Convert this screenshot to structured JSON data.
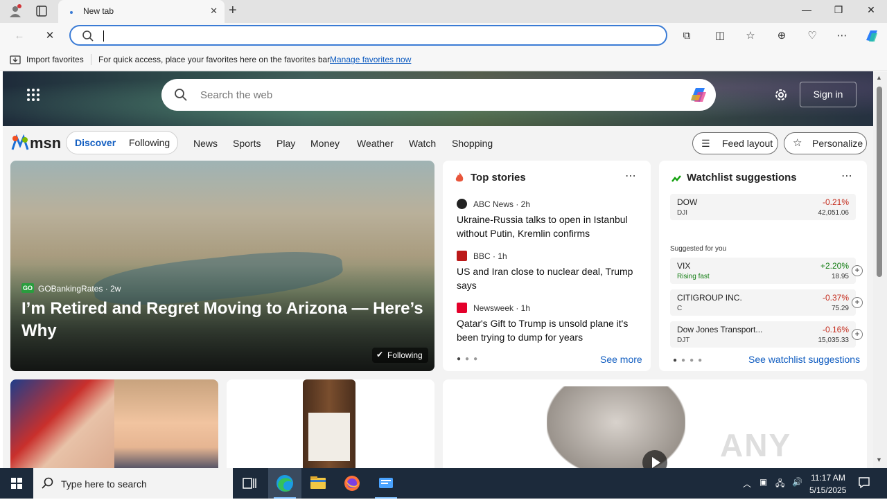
{
  "browser": {
    "tab_title": "New tab",
    "address_value": "",
    "favorites_bar": {
      "import_label": "Import favorites",
      "message": "For quick access, place your favorites here on the favorites bar.",
      "manage_link": "Manage favorites now"
    }
  },
  "msn": {
    "search_placeholder": "Search the web",
    "sign_in": "Sign in",
    "logo": "msn",
    "segments": [
      "Discover",
      "Following"
    ],
    "nav": [
      "News",
      "Sports",
      "Play",
      "Money",
      "Weather",
      "Watch",
      "Shopping"
    ],
    "feed_layout": "Feed layout",
    "personalize": "Personalize",
    "featured": {
      "source": "GOBankingRates",
      "age": "2w",
      "headline": "I’m Retired and Regret Moving to Arizona — Here’s Why",
      "following": "Following"
    },
    "top_stories": {
      "title": "Top stories",
      "stories": [
        {
          "source": "ABC News · 2h",
          "headline": "Ukraine-Russia talks to open in Istanbul without Putin, Kremlin confirms"
        },
        {
          "source": "BBC · 1h",
          "headline": "US and Iran close to nuclear deal, Trump says"
        },
        {
          "source": "Newsweek · 1h",
          "headline": "Qatar's Gift to Trump is unsold plane it's been trying to dump for years"
        }
      ],
      "see_more": "See more"
    },
    "watchlist": {
      "title": "Watchlist suggestions",
      "suggested_label": "Suggested for you",
      "see_all": "See watchlist suggestions",
      "items": [
        {
          "name": "DOW",
          "sub": "DJI",
          "pct": "-0.21%",
          "value": "42,051.06",
          "dir": "down"
        },
        {
          "name": "VIX",
          "sub": "Rising fast",
          "pct": "+2.20%",
          "value": "18.95",
          "dir": "up"
        },
        {
          "name": "CITIGROUP INC.",
          "sub": "C",
          "pct": "-0.37%",
          "value": "75.29",
          "dir": "down"
        },
        {
          "name": "Dow Jones Transport...",
          "sub": "DJT",
          "pct": "-0.16%",
          "value": "15,035.33",
          "dir": "down"
        }
      ]
    }
  },
  "taskbar": {
    "search_placeholder": "Type here to search",
    "time": "11:17 AM",
    "date": "5/15/2025"
  },
  "watermark": "ANY RUN",
  "colors": {
    "accent": "#0f5cc0",
    "down": "#c42b1c",
    "up": "#107c10",
    "taskbar": "#1c2a3b"
  }
}
